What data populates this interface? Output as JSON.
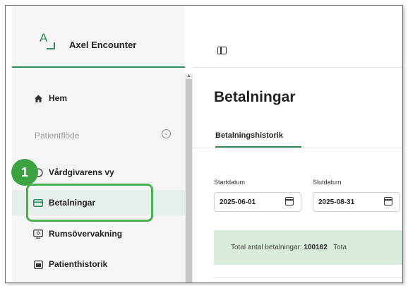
{
  "brand": {
    "name": "Axel Encounter",
    "logo_letter": "A"
  },
  "sidebar": {
    "group_label": "Patientflöde",
    "items": [
      {
        "label": "Hem",
        "icon": "home-icon"
      },
      {
        "label": "Vårdgivarens vy",
        "icon": "user-circle-icon"
      },
      {
        "label": "Betalningar",
        "icon": "credit-card-icon",
        "active": true
      },
      {
        "label": "Rumsövervakning",
        "icon": "monitor-icon"
      },
      {
        "label": "Patienthistorik",
        "icon": "calendar-icon"
      }
    ]
  },
  "callout": {
    "number": "1"
  },
  "main": {
    "title": "Betalningar",
    "tabs": [
      {
        "label": "Betalningshistorik",
        "active": true
      }
    ],
    "filters": {
      "start": {
        "label": "Startdatum",
        "value": "2025-06-01"
      },
      "end": {
        "label": "Slutdatum",
        "value": "2025-08-31"
      }
    },
    "summary": {
      "total_label": "Total antal betalningar:",
      "total_value": "100162",
      "next_label_partial": "Tota"
    }
  },
  "colors": {
    "accent": "#2e8b57",
    "highlight": "#4caf50",
    "summary_bg": "#d9ecdc"
  }
}
